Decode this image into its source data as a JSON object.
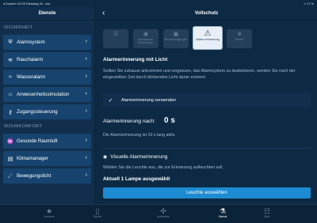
{
  "status_bar": {
    "left": "◂ Suchen  10:09  Dienstag 31. Jan.",
    "right": "≈ 71 %"
  },
  "sidebar": {
    "title": "Dienste",
    "sections": [
      {
        "title": "SICHERHEIT",
        "items": [
          {
            "label": "Alarmsystem",
            "icon": "shield-icon"
          },
          {
            "label": "Rauchalarm",
            "icon": "smoke-icon"
          },
          {
            "label": "Wasseralarm",
            "icon": "water-icon"
          },
          {
            "label": "Anwesenheitssimulation",
            "icon": "house-icon"
          },
          {
            "label": "Zugangssteuerung",
            "icon": "key-icon"
          }
        ]
      },
      {
        "title": "WOHNKOMFORT",
        "items": [
          {
            "label": "Gesunde Raumluft",
            "icon": "air-icon"
          },
          {
            "label": "Klimamanager",
            "icon": "climate-icon"
          },
          {
            "label": "Bewegungslicht",
            "icon": "motion-light-icon"
          }
        ]
      }
    ]
  },
  "main": {
    "title": "Vollschutz",
    "tiles": [
      {
        "label": "",
        "icon": "list-icon"
      },
      {
        "label": "Alarmsystem-Einstellungen",
        "icon": "eye-icon"
      },
      {
        "label": "Benachrichtigungen",
        "icon": "bell-icon"
      },
      {
        "label": "Alarm-erinnerung",
        "icon": "warning-icon"
      },
      {
        "label": "Weitere",
        "icon": "more-icon"
      }
    ],
    "heading": "Alarmerinnerung mit Licht",
    "description": "Sollten Sie zuhause ankommen und vergessen, das Alarmsystem zu deaktivieren, werden Sie nach der eingestellten Zeit durch blinkendes Licht daran erinnert.",
    "checkbox_label": "Alarmerinnerung verwenden",
    "checkbox_checked": true,
    "delay_label": "Alarmerinnerung nach:",
    "delay_value": "0 s",
    "delay_info": "Die Alarmerinnerung ist 10 s lang aktiv.",
    "visual_title": "Visuelle Alarmerinnerung",
    "visual_desc": "Wählen Sie die Leuchte aus, die zur Erinnerung aufleuchten soll.",
    "lamp_count": "Aktuell 1 Lampe ausgewählt",
    "lamp_button": "Leuchte auswählen"
  },
  "tabbar": {
    "tabs": [
      {
        "label": "Favoriten",
        "icon": "star-icon"
      },
      {
        "label": "Räume",
        "icon": "door-icon"
      },
      {
        "label": "Automation",
        "icon": "automation-icon"
      },
      {
        "label": "Dienste",
        "icon": "flask-icon"
      },
      {
        "label": "Mehr",
        "icon": "more-icon"
      }
    ],
    "active_index": 3
  },
  "colors": {
    "background": "#0d2a45",
    "sidebar_item": "#17446e",
    "accent": "#1c8bd1"
  }
}
